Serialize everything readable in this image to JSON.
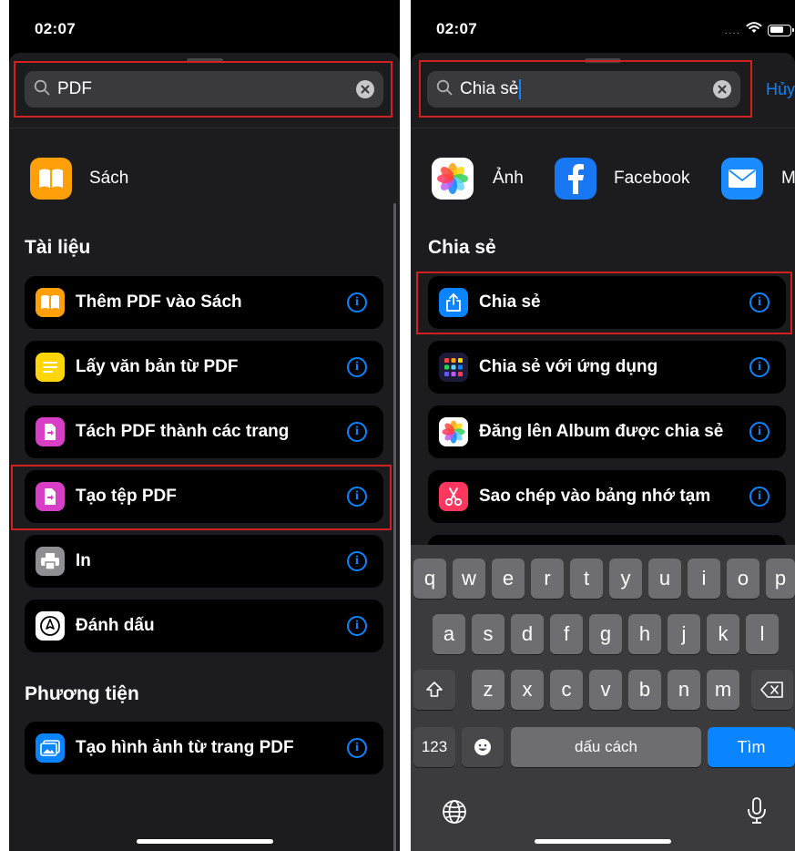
{
  "status": {
    "time": "02:07"
  },
  "left": {
    "search_value": "PDF",
    "top_app": {
      "label": "Sách",
      "icon": "books-icon"
    },
    "sections": [
      {
        "title": "Tài liệu",
        "items": [
          {
            "label": "Thêm PDF vào Sách",
            "icon": "books-icon",
            "color": "#ff9f0a"
          },
          {
            "label": "Lấy văn bản từ PDF",
            "icon": "text-lines-icon",
            "color": "#ffd60a"
          },
          {
            "label": "Tách PDF thành các trang",
            "icon": "document-icon",
            "color": "#d93ec7"
          },
          {
            "label": "Tạo tệp PDF",
            "icon": "document-icon",
            "color": "#d93ec7"
          },
          {
            "label": "In",
            "icon": "printer-icon",
            "color": "#8e8e93"
          },
          {
            "label": "Đánh dấu",
            "icon": "markup-pen-icon",
            "color": "#ffffff"
          }
        ]
      },
      {
        "title": "Phương tiện",
        "items": [
          {
            "label": "Tạo hình ảnh từ trang PDF",
            "icon": "photos-icon",
            "color": "#0a84ff"
          }
        ]
      }
    ]
  },
  "right": {
    "search_value": "Chia sẻ",
    "cancel_label": "Hủy",
    "apps": [
      {
        "label": "Ảnh",
        "icon": "photos-flower-icon"
      },
      {
        "label": "Facebook",
        "icon": "facebook-icon"
      },
      {
        "label": "M",
        "icon": "mail-icon"
      }
    ],
    "section_title": "Chia sẻ",
    "items": [
      {
        "label": "Chia sẻ",
        "icon": "share-icon",
        "color": "#0a84ff"
      },
      {
        "label": "Chia sẻ với ứng dụng",
        "icon": "app-grid-icon",
        "color": "#1c1c3a"
      },
      {
        "label": "Đăng lên Album được chia sẻ",
        "icon": "photos-flower-icon",
        "color": "#ffffff"
      },
      {
        "label": "Sao chép vào bảng nhớ tạm",
        "icon": "scissors-icon",
        "color": "#ff375f"
      }
    ],
    "keyboard": {
      "row1": [
        "q",
        "w",
        "e",
        "r",
        "t",
        "y",
        "u",
        "i",
        "o",
        "p"
      ],
      "row2": [
        "a",
        "s",
        "d",
        "f",
        "g",
        "h",
        "j",
        "k",
        "l"
      ],
      "row3": [
        "z",
        "x",
        "c",
        "v",
        "b",
        "n",
        "m"
      ],
      "numbers_label": "123",
      "space_label": "dấu cách",
      "search_label": "Tìm"
    }
  }
}
